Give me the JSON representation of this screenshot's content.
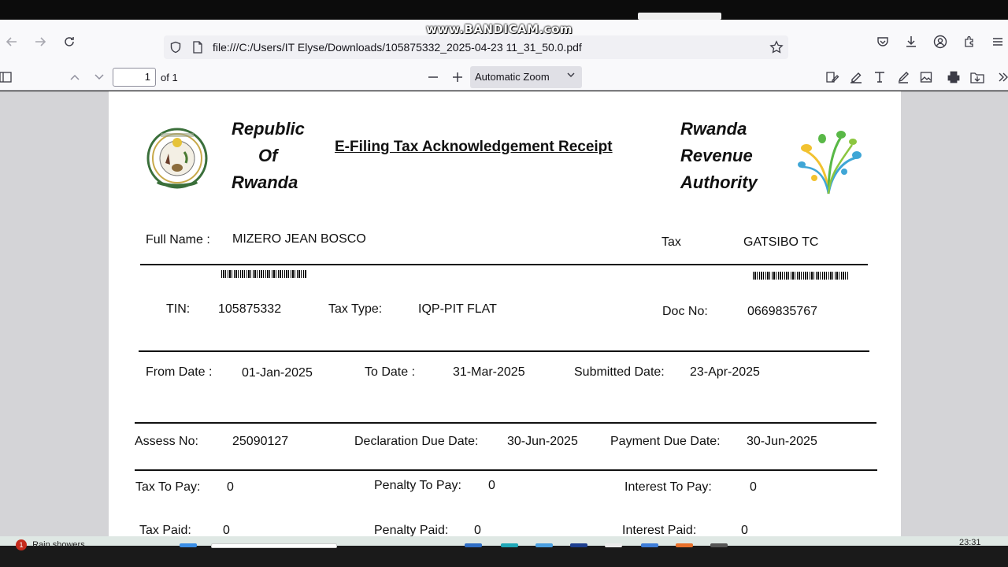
{
  "watermark": "www.BANDICAM.com",
  "browser": {
    "url": "file:///C:/Users/IT Elyse/Downloads/105875332_2025-04-23 11_31_50.0.pdf"
  },
  "pdf_toolbar": {
    "page_number": "1",
    "page_count": "of 1",
    "zoom": "Automatic Zoom"
  },
  "document": {
    "header": {
      "left_line1": "Republic",
      "left_line2": "Of",
      "left_line3": "Rwanda",
      "title": "E-Filing Tax Acknowledgement Receipt",
      "right_line1": "Rwanda",
      "right_line2": "Revenue",
      "right_line3": "Authority"
    },
    "full_name_label": "Full Name :",
    "full_name_value": "MIZERO JEAN BOSCO",
    "tax_office_label": "Tax",
    "tax_office_value": "GATSIBO TC",
    "tin_label": "TIN:",
    "tin_value": "105875332",
    "tax_type_label": "Tax Type:",
    "tax_type_value": "IQP-PIT FLAT",
    "doc_no_label": "Doc No:",
    "doc_no_value": "0669835767",
    "from_date_label": "From  Date :",
    "from_date_value": "01-Jan-2025",
    "to_date_label": "To Date :",
    "to_date_value": "31-Mar-2025",
    "submitted_label": "Submitted Date:",
    "submitted_value": "23-Apr-2025",
    "assess_label": "Assess No:",
    "assess_value": "25090127",
    "decl_due_label": "Declaration Due Date:",
    "decl_due_value": "30-Jun-2025",
    "pay_due_label": "Payment Due Date:",
    "pay_due_value": "30-Jun-2025",
    "tax_to_pay_label": "Tax To Pay:",
    "tax_to_pay_value": "0",
    "penalty_to_pay_label": "Penalty To Pay:",
    "penalty_to_pay_value": "0",
    "interest_to_pay_label": "Interest To Pay:",
    "interest_to_pay_value": "0",
    "tax_paid_label": "Tax Paid:",
    "tax_paid_value": "0",
    "penalty_paid_label": "Penalty Paid:",
    "penalty_paid_value": "0",
    "interest_paid_label": "Interest Paid:",
    "interest_paid_value": "0"
  },
  "taskbar": {
    "notification_count": "1",
    "weather": "Rain showers",
    "time": "23:31"
  },
  "icons": {
    "back": "arrow-left-icon",
    "forward": "arrow-right-icon",
    "reload": "reload-icon",
    "shield": "shield-icon",
    "page": "page-icon",
    "star": "star-icon",
    "pocket": "pocket-icon",
    "download": "download-icon",
    "account": "account-icon",
    "extensions": "extensions-icon",
    "menu": "menu-icon"
  }
}
